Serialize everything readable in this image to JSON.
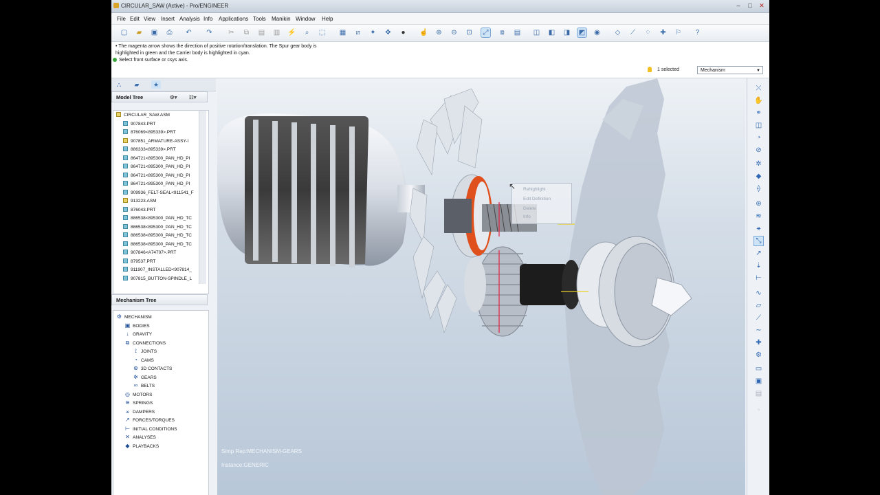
{
  "window": {
    "title": "CIRCULAR_SAW (Active) - Pro/ENGINEER",
    "controls": [
      "–",
      "□",
      "✕"
    ]
  },
  "menu": [
    "File",
    "Edit",
    "View",
    "Insert",
    "Analysis",
    "Info",
    "Applications",
    "Tools",
    "Manikin",
    "Window",
    "Help"
  ],
  "messages": {
    "line1": "• The magenta arrow shows the direction of positive rotation/translation. The Spur gear body is",
    "line2": "highlighted in green and the Carrier body is highlighted in cyan.",
    "line3": "Select front surface or csys axis."
  },
  "status": {
    "selected": "1 selected",
    "mode": "Mechanism"
  },
  "model_tree": {
    "header": "Model Tree",
    "items": [
      {
        "label": "CIRCULAR_SAW.ASM",
        "type": "asm"
      },
      {
        "label": "907843.PRT",
        "type": "prt"
      },
      {
        "label": "876069<895339>.PRT",
        "type": "prt"
      },
      {
        "label": "907851_ARMATURE-ASSY-I",
        "type": "asm"
      },
      {
        "label": "886333<895339>.PRT",
        "type": "prt"
      },
      {
        "label": "864721<895300_PAN_HD_PI",
        "type": "prt"
      },
      {
        "label": "864721<895300_PAN_HD_PI",
        "type": "prt"
      },
      {
        "label": "864721<895300_PAN_HD_PI",
        "type": "prt"
      },
      {
        "label": "864721<895300_PAN_HD_PI",
        "type": "prt"
      },
      {
        "label": "909936_FELT-SEAL<911541_F",
        "type": "prt"
      },
      {
        "label": "913223.ASM",
        "type": "asm"
      },
      {
        "label": "876043.PRT",
        "type": "prt"
      },
      {
        "label": "886538<895300_PAN_HD_TC",
        "type": "prt"
      },
      {
        "label": "886538<895300_PAN_HD_TC",
        "type": "prt"
      },
      {
        "label": "886538<895300_PAN_HD_TC",
        "type": "prt"
      },
      {
        "label": "886538<895300_PAN_HD_TC",
        "type": "prt"
      },
      {
        "label": "907846<A74707>.PRT",
        "type": "prt"
      },
      {
        "label": "879537.PRT",
        "type": "prt"
      },
      {
        "label": "911907_INSTALLED<907814_",
        "type": "prt"
      },
      {
        "label": "907815_BUTTON-SPINDLE_L",
        "type": "prt"
      }
    ]
  },
  "mechanism_tree": {
    "header": "Mechanism Tree",
    "items": [
      {
        "label": "MECHANISM",
        "icon": "⚙",
        "indent": 0
      },
      {
        "label": "BODIES",
        "icon": "▣",
        "indent": 1
      },
      {
        "label": "GRAVITY",
        "icon": "↓",
        "indent": 1
      },
      {
        "label": "CONNECTIONS",
        "icon": "⧉",
        "indent": 1
      },
      {
        "label": "JOINTS",
        "icon": "⟟",
        "indent": 2
      },
      {
        "label": "CAMS",
        "icon": "◔",
        "indent": 2
      },
      {
        "label": "3D CONTACTS",
        "icon": "⊛",
        "indent": 2
      },
      {
        "label": "GEARS",
        "icon": "✲",
        "indent": 2
      },
      {
        "label": "BELTS",
        "icon": "∞",
        "indent": 2
      },
      {
        "label": "MOTORS",
        "icon": "◎",
        "indent": 1
      },
      {
        "label": "SPRINGS",
        "icon": "≋",
        "indent": 1
      },
      {
        "label": "DAMPERS",
        "icon": "⚹",
        "indent": 1
      },
      {
        "label": "FORCES/TORQUES",
        "icon": "↗",
        "indent": 1
      },
      {
        "label": "INITIAL CONDITIONS",
        "icon": "⊢",
        "indent": 1
      },
      {
        "label": "ANALYSES",
        "icon": "✕",
        "indent": 1
      },
      {
        "label": "PLAYBACKS",
        "icon": "◆",
        "indent": 1
      }
    ]
  },
  "context_menu": [
    "Rehighlight",
    "Edit Definition",
    "Delete",
    "Info"
  ],
  "viewport": {
    "simp_rep": "Simp Rep:MECHANISM-GEARS",
    "instance": "Instance:GENERIC"
  },
  "colors": {
    "accent": "#2f67b3",
    "highlight_orange": "#e0501c",
    "viewport_top": "#eef2f6",
    "viewport_bottom": "#b8c7d8"
  }
}
